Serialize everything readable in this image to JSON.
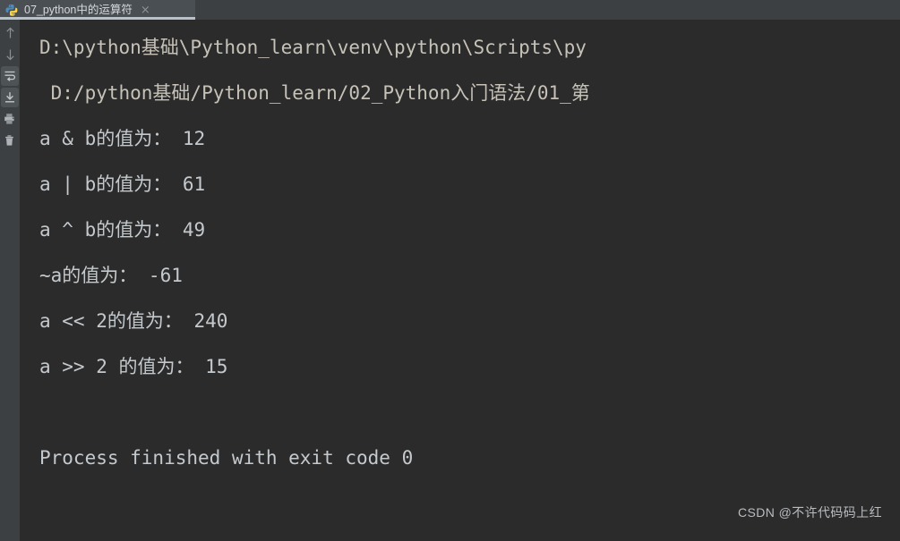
{
  "window": {
    "background_color": "#2b2b2b",
    "chrome_color": "#3c4043"
  },
  "tabbar": {
    "tabs": [
      {
        "label": "07_python中的运算符",
        "icon": "python-icon",
        "close_label": "×",
        "active": true
      }
    ]
  },
  "sidebar": {
    "buttons": [
      {
        "name": "up-arrow-icon",
        "tooltip": "Up",
        "active": false
      },
      {
        "name": "down-arrow-icon",
        "tooltip": "Down",
        "active": false
      },
      {
        "name": "soft-wrap-icon",
        "tooltip": "Soft-Wrap",
        "active": true
      },
      {
        "name": "scroll-to-end-icon",
        "tooltip": "Scroll to End",
        "active": true
      },
      {
        "name": "print-icon",
        "tooltip": "Print",
        "active": false
      },
      {
        "name": "trash-icon",
        "tooltip": "Clear All",
        "active": false
      }
    ]
  },
  "console": {
    "lines": [
      {
        "text": "D:\\python基础\\Python_learn\\venv\\python\\Scripts\\py",
        "kind": "path"
      },
      {
        "text": " D:/python基础/Python_learn/02_Python入门语法/01_第",
        "kind": "path"
      },
      {
        "text": "a & b的值为： 12",
        "kind": "out"
      },
      {
        "text": "a | b的值为： 61",
        "kind": "out"
      },
      {
        "text": "a ^ b的值为： 49",
        "kind": "out"
      },
      {
        "text": "~a的值为： -61",
        "kind": "out"
      },
      {
        "text": "a << 2的值为： 240",
        "kind": "out"
      },
      {
        "text": "a >> 2 的值为： 15",
        "kind": "out"
      },
      {
        "text": "",
        "kind": "blank"
      },
      {
        "text": "Process finished with exit code 0",
        "kind": "out"
      }
    ]
  },
  "watermark": {
    "text": "CSDN @不许代码码上红"
  }
}
